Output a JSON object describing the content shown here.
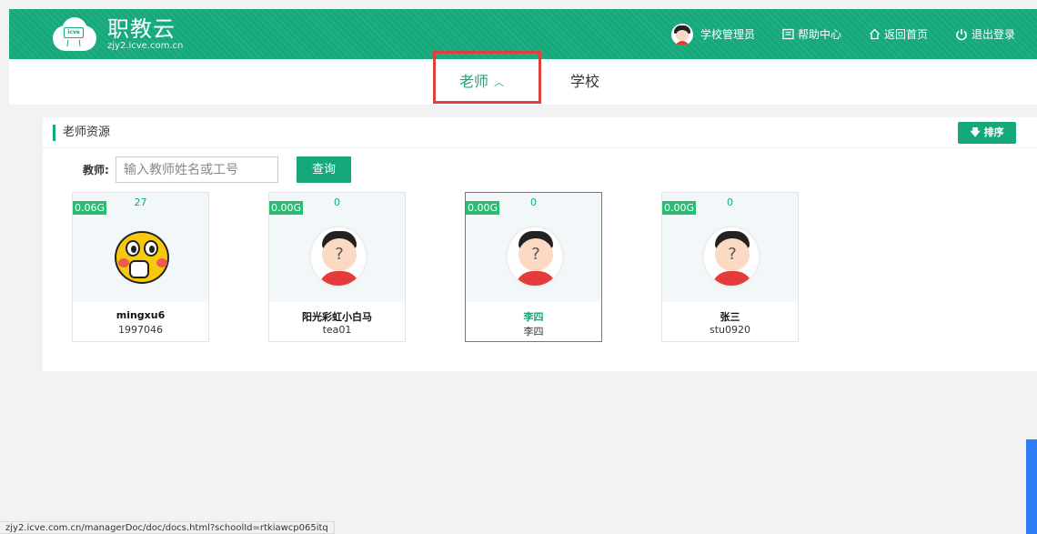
{
  "header": {
    "logo_title": "职教云",
    "logo_subtitle": "zjy2.icve.com.cn",
    "logo_badge": "icve",
    "nav": [
      {
        "label": "学校管理员",
        "icon": "avatar-icon"
      },
      {
        "label": "帮助中心",
        "icon": "help-book-icon"
      },
      {
        "label": "返回首页",
        "icon": "home-icon"
      },
      {
        "label": "退出登录",
        "icon": "power-icon"
      }
    ]
  },
  "tabs": [
    {
      "label": "老师",
      "active": true,
      "expand_icon": "chevron-up-icon"
    },
    {
      "label": "学校",
      "active": false
    }
  ],
  "section": {
    "title": "老师资源",
    "sort_label": "排序",
    "sort_icon": "arrow-down-icon"
  },
  "search": {
    "label": "教师:",
    "placeholder": "输入教师姓名或工号",
    "value": "",
    "button_label": "查询"
  },
  "teachers": [
    {
      "storage": "0.06G",
      "count": "27",
      "name": "mingxu6",
      "code": "1997046",
      "avatar": "duck-avatar",
      "selected": false
    },
    {
      "storage": "0.00G",
      "count": "0",
      "name": "阳光彩虹小白马",
      "code": "tea01",
      "avatar": "default-avatar",
      "selected": false
    },
    {
      "storage": "0.00G",
      "count": "0",
      "name": "李四",
      "code": "李四",
      "avatar": "default-avatar",
      "selected": true
    },
    {
      "storage": "0.00G",
      "count": "0",
      "name": "张三",
      "code": "stu0920",
      "avatar": "default-avatar",
      "selected": false
    }
  ],
  "status_bar": {
    "url": "zjy2.icve.com.cn/managerDoc/doc/docs.html?schoolId=rtkiawcp065itq"
  },
  "colors": {
    "brand": "#14a87a",
    "badge": "#2dbb74",
    "highlight": "#e0403d",
    "side_tab": "#2f7df6"
  }
}
